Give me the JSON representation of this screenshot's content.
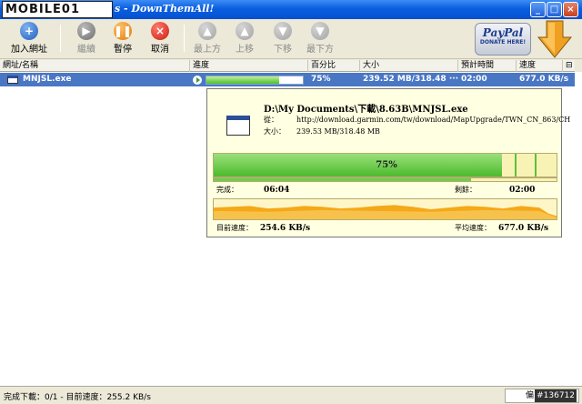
{
  "window": {
    "logo_text": "MOBILE01",
    "title": "s - DownThemAll!",
    "min": "_",
    "max": "□",
    "close": "×"
  },
  "toolbar": {
    "add_url": "加入網址",
    "resume": "繼續",
    "pause": "暫停",
    "cancel": "取消",
    "move_top": "最上方",
    "move_up": "上移",
    "move_down": "下移",
    "move_bottom": "最下方",
    "add_glyph": "+",
    "cancel_glyph": "×"
  },
  "donate": {
    "brand": "PayPal",
    "text": "DONATE HERE!"
  },
  "columns": {
    "url": "網址/名稱",
    "progress": "進度",
    "percent": "百分比",
    "size": "大小",
    "eta": "預計時間",
    "speed": "速度",
    "picker": "⊟"
  },
  "rows": [
    {
      "name": "MNJSL.exe",
      "progress": 0.75,
      "percent": "75%",
      "size": "239.52 MB/318.48 ···",
      "eta": "02:00",
      "speed": "677.0 KB/s"
    }
  ],
  "popup": {
    "path": "D:\\My Documents\\下載\\8.63B\\MNJSL.exe",
    "from_label": "從：",
    "from_value": "http://download.garmin.com/tw/download/MapUpgrade/TWN_CN_863/CH",
    "size_label": "大小：",
    "size_value": "239.53 MB/318.48 MB",
    "progress": 0.75,
    "progress_pct": "75%",
    "done_label": "完成：",
    "done_value": "06:04",
    "remain_label": "剩餘：",
    "remain_value": "02:00",
    "cur_speed_label": "目前速度：",
    "cur_speed_value": "254.6 KB/s",
    "avg_speed_label": "平均速度：",
    "avg_speed_value": "677.0 KB/s"
  },
  "statusbar": {
    "text": "完成下載：0/1 - 目前速度：255.2 KB/s",
    "cell_text": "偏",
    "watermark": "#136712"
  }
}
